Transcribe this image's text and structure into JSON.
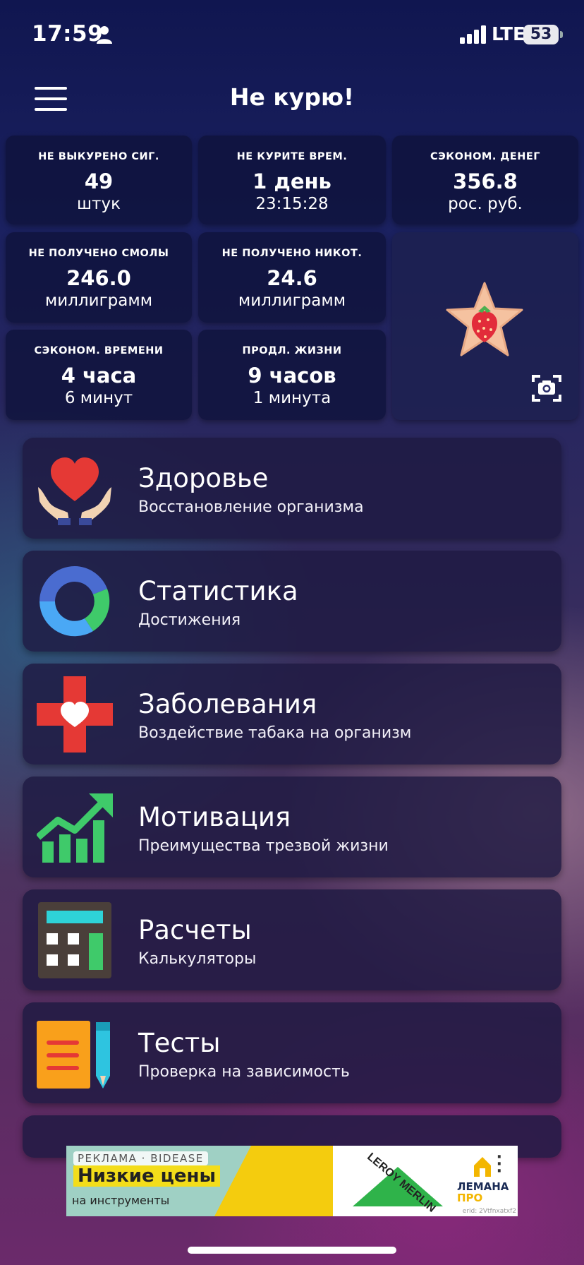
{
  "status_bar": {
    "time": "17:59",
    "network": "LTE",
    "battery": "53"
  },
  "header": {
    "title": "Не курю!"
  },
  "stats": [
    {
      "label": "НЕ ВЫКУРЕНО СИГ.",
      "value": "49",
      "unit": "штук"
    },
    {
      "label": "НЕ КУРИТЕ ВРЕМ.",
      "value": "1 день",
      "unit": "23:15:28"
    },
    {
      "label": "СЭКОНОМ. ДЕНЕГ",
      "value": "356.8",
      "unit": "рос. руб."
    },
    {
      "label": "НЕ ПОЛУЧЕНО СМОЛЫ",
      "value": "246.0",
      "unit": "миллиграмм"
    },
    {
      "label": "НЕ ПОЛУЧЕНО НИКОТ.",
      "value": "24.6",
      "unit": "миллиграмм"
    },
    {
      "label": "СЭКОНОМ. ВРЕМЕНИ",
      "value": "4 часа",
      "unit": "6 минут"
    },
    {
      "label": "ПРОДЛ. ЖИЗНИ",
      "value": "9 часов",
      "unit": "1 минута"
    }
  ],
  "menu": [
    {
      "title": "Здоровье",
      "subtitle": "Восстановление организма",
      "icon": "heart-hands-icon"
    },
    {
      "title": "Статистика",
      "subtitle": "Достижения",
      "icon": "ring-chart-icon"
    },
    {
      "title": "Заболевания",
      "subtitle": "Воздействие табака на организм",
      "icon": "medical-cross-icon"
    },
    {
      "title": "Мотивация",
      "subtitle": "Преимущества трезвой жизни",
      "icon": "growth-chart-icon"
    },
    {
      "title": "Расчеты",
      "subtitle": "Калькуляторы",
      "icon": "calculator-icon"
    },
    {
      "title": "Тесты",
      "subtitle": "Проверка на зависимость",
      "icon": "notepad-pencil-icon"
    }
  ],
  "ad": {
    "tag": "РЕКЛАМА · BIDEASE",
    "headline": "Низкие цены",
    "subline": "на инструменты",
    "brand1": "LEROY MERLIN",
    "brand2_line1": "ЛЕМАНА",
    "brand2_line2": "ПРО",
    "erid": "erid: 2Vtfnxatxf2"
  },
  "colors": {
    "accent_red": "#e53935",
    "accent_blue": "#4a8ef0",
    "accent_green": "#3fca6a"
  }
}
